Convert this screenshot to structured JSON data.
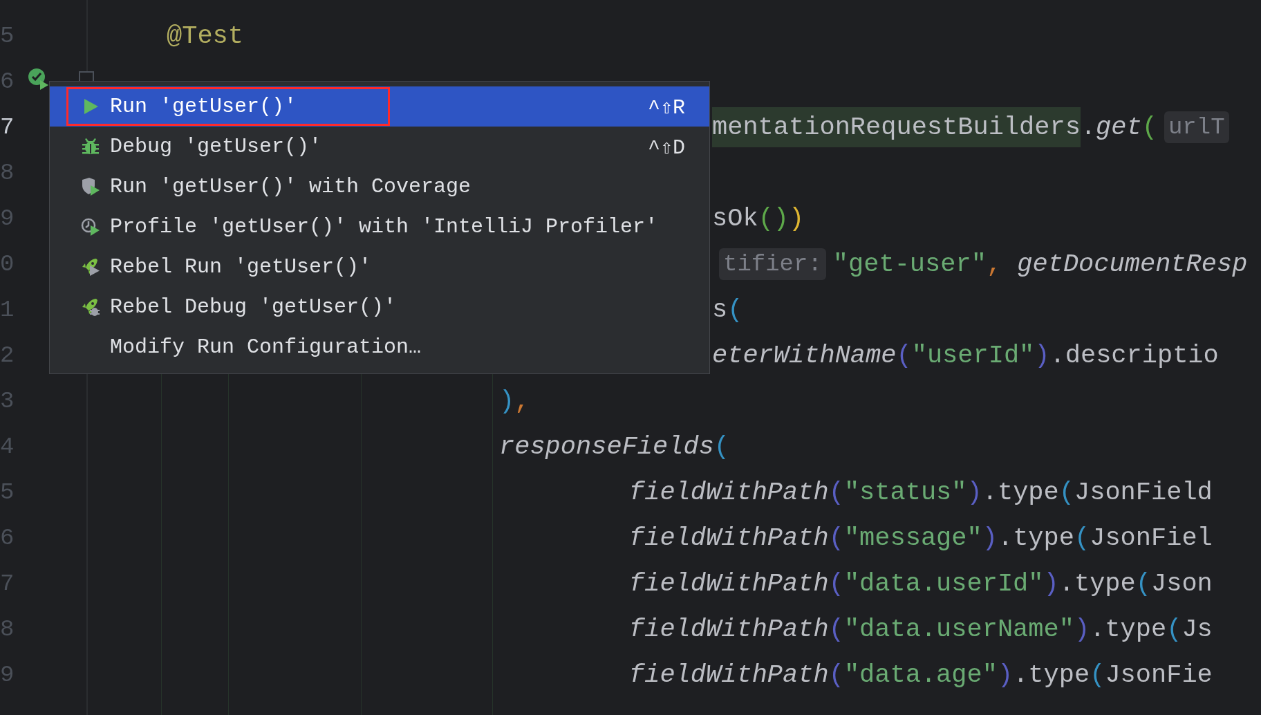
{
  "editor": {
    "lines": [
      {
        "number": "5",
        "current": false,
        "kind": "top",
        "tokens": [
          {
            "text": "@Test",
            "kind": "annotation"
          }
        ]
      },
      {
        "number": "6",
        "current": false
      },
      {
        "number": "7",
        "current": true,
        "kind": "cut",
        "tokens": [
          {
            "text": "mentationRequestBuilders",
            "kind": "match"
          },
          {
            "text": ".",
            "kind": "plain"
          },
          {
            "text": "get",
            "kind": "italic"
          },
          {
            "text": "(",
            "kind": "green"
          },
          {
            "text": "urlT",
            "kind": "hint"
          }
        ]
      },
      {
        "number": "8",
        "current": false
      },
      {
        "number": "9",
        "current": false,
        "kind": "cut",
        "tokens": [
          {
            "text": "sOk",
            "kind": "plain"
          },
          {
            "text": "()",
            "kind": "green"
          },
          {
            "text": ")",
            "kind": "yellow"
          }
        ]
      },
      {
        "number": "0",
        "current": false,
        "kind": "cut",
        "tokens": [
          {
            "text": "tifier:",
            "kind": "hint"
          },
          {
            "text": "\"get-user\"",
            "kind": "string"
          },
          {
            "text": ",",
            "kind": "orange"
          },
          {
            "text": " getDocumentResp",
            "kind": "italic"
          }
        ]
      },
      {
        "number": "1",
        "current": false,
        "kind": "cut",
        "tokens": [
          {
            "text": "s",
            "kind": "plain"
          },
          {
            "text": "(",
            "kind": "blue"
          }
        ]
      },
      {
        "number": "2",
        "current": false,
        "kind": "cut",
        "tokens": [
          {
            "text": "eterWithName",
            "kind": "italic"
          },
          {
            "text": "(",
            "kind": "purple"
          },
          {
            "text": "\"userId\"",
            "kind": "string"
          },
          {
            "text": ")",
            "kind": "purple"
          },
          {
            "text": ".descriptio",
            "kind": "plain"
          }
        ]
      },
      {
        "number": "3",
        "current": false,
        "kind": "mid",
        "tokens": [
          {
            "text": ")",
            "kind": "blue"
          },
          {
            "text": ",",
            "kind": "orange"
          }
        ]
      },
      {
        "number": "4",
        "current": false,
        "kind": "mid",
        "tokens": [
          {
            "text": "responseFields",
            "kind": "italic"
          },
          {
            "text": "(",
            "kind": "blue"
          }
        ]
      },
      {
        "number": "5",
        "current": false,
        "kind": "deep",
        "tokens": [
          {
            "text": "fieldWithPath",
            "kind": "italic"
          },
          {
            "text": "(",
            "kind": "purple"
          },
          {
            "text": "\"status\"",
            "kind": "string"
          },
          {
            "text": ")",
            "kind": "purple"
          },
          {
            "text": ".type",
            "kind": "plain"
          },
          {
            "text": "(",
            "kind": "blue"
          },
          {
            "text": "JsonField",
            "kind": "plain"
          }
        ]
      },
      {
        "number": "6",
        "current": false,
        "kind": "deep",
        "tokens": [
          {
            "text": "fieldWithPath",
            "kind": "italic"
          },
          {
            "text": "(",
            "kind": "purple"
          },
          {
            "text": "\"message\"",
            "kind": "string"
          },
          {
            "text": ")",
            "kind": "purple"
          },
          {
            "text": ".type",
            "kind": "plain"
          },
          {
            "text": "(",
            "kind": "blue"
          },
          {
            "text": "JsonFiel",
            "kind": "plain"
          }
        ]
      },
      {
        "number": "7",
        "current": false,
        "kind": "deep",
        "tokens": [
          {
            "text": "fieldWithPath",
            "kind": "italic"
          },
          {
            "text": "(",
            "kind": "purple"
          },
          {
            "text": "\"data.userId\"",
            "kind": "string"
          },
          {
            "text": ")",
            "kind": "purple"
          },
          {
            "text": ".type",
            "kind": "plain"
          },
          {
            "text": "(",
            "kind": "blue"
          },
          {
            "text": "Json",
            "kind": "plain"
          }
        ]
      },
      {
        "number": "8",
        "current": false,
        "kind": "deep",
        "tokens": [
          {
            "text": "fieldWithPath",
            "kind": "italic"
          },
          {
            "text": "(",
            "kind": "purple"
          },
          {
            "text": "\"data.userName\"",
            "kind": "string"
          },
          {
            "text": ")",
            "kind": "purple"
          },
          {
            "text": ".type",
            "kind": "plain"
          },
          {
            "text": "(",
            "kind": "blue"
          },
          {
            "text": "Js",
            "kind": "plain"
          }
        ]
      },
      {
        "number": "9",
        "current": false,
        "kind": "deep",
        "tokens": [
          {
            "text": "fieldWithPath",
            "kind": "italic"
          },
          {
            "text": "(",
            "kind": "purple"
          },
          {
            "text": "\"data.age\"",
            "kind": "string"
          },
          {
            "text": ")",
            "kind": "purple"
          },
          {
            "text": ".type",
            "kind": "plain"
          },
          {
            "text": "(",
            "kind": "blue"
          },
          {
            "text": "JsonFie",
            "kind": "plain"
          }
        ]
      }
    ]
  },
  "popup": {
    "items": [
      {
        "kind": "run",
        "label": "Run 'getUser()'",
        "shortcut": "^⇧R",
        "selected": true,
        "annotated": true
      },
      {
        "kind": "debug",
        "label": "Debug 'getUser()'",
        "shortcut": "^⇧D",
        "selected": false,
        "annotated": false
      },
      {
        "kind": "coverage",
        "label": "Run 'getUser()' with Coverage",
        "selected": false,
        "annotated": false
      },
      {
        "kind": "profile",
        "label": "Profile 'getUser()' with 'IntelliJ Profiler'",
        "selected": false,
        "annotated": false
      },
      {
        "kind": "rebel-run",
        "label": "Rebel Run 'getUser()'",
        "selected": false,
        "annotated": false
      },
      {
        "kind": "rebel-debug",
        "label": "Rebel Debug 'getUser()'",
        "selected": false,
        "annotated": false
      },
      {
        "kind": "none",
        "label": "Modify Run Configuration…",
        "selected": false,
        "annotated": false
      }
    ]
  }
}
